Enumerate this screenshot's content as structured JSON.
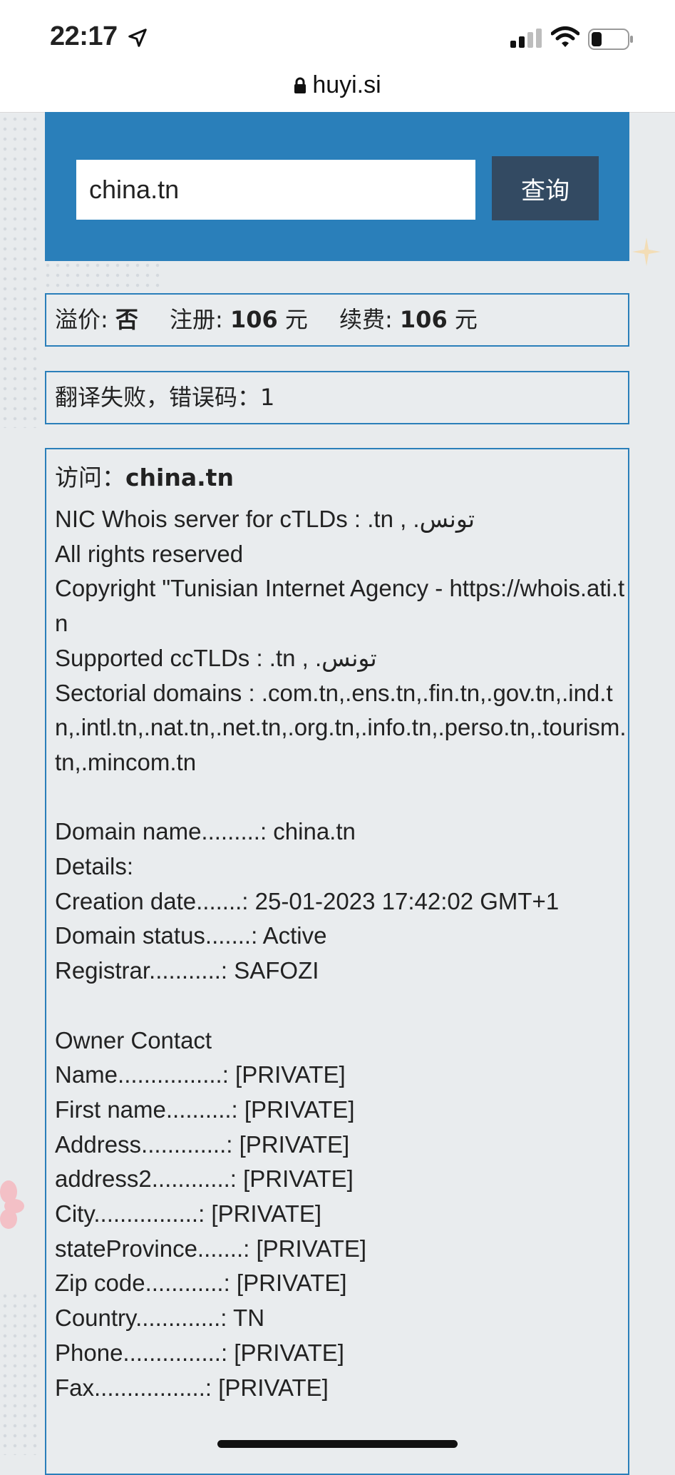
{
  "status_bar": {
    "time": "22:17",
    "icons": [
      "location-arrow-icon",
      "cellular-signal-icon",
      "wifi-icon",
      "battery-icon"
    ]
  },
  "browser": {
    "url": "huyi.si",
    "lock_icon": "lock-icon"
  },
  "search": {
    "value": "china.tn",
    "button_label": "查询"
  },
  "price": {
    "premium_label": "溢价:",
    "premium_value": "否",
    "register_label": "注册:",
    "register_value": "106",
    "register_unit": "元",
    "renew_label": "续费:",
    "renew_value": "106",
    "renew_unit": "元"
  },
  "translation_error": "翻译失败，错误码：1",
  "whois": {
    "visit_label": "访问：",
    "visit_domain": "china.tn",
    "lines": [
      "NIC Whois server for cTLDs : .tn , .تونس",
      "All rights reserved",
      "Copyright \"Tunisian Internet Agency - https://whois.ati.tn",
      "Supported ccTLDs : .tn , .تونس",
      "Sectorial domains : .com.tn,.ens.tn,.fin.tn,.gov.tn,.ind.tn,.intl.tn,.nat.tn,.net.tn,.org.tn,.info.tn,.perso.tn,.tourism.tn,.mincom.tn",
      "",
      "Domain name.........: china.tn",
      "Details:",
      "Creation date.......: 25-01-2023 17:42:02 GMT+1",
      "Domain status.......: Active",
      "Registrar...........: SAFOZI",
      "",
      "Owner Contact",
      "Name................: [PRIVATE]",
      "First name..........: [PRIVATE]",
      "Address.............: [PRIVATE]",
      "address2............: [PRIVATE]",
      "City................: [PRIVATE]",
      "stateProvince.......: [PRIVATE]",
      "Zip code............: [PRIVATE]",
      "Country.............: TN",
      "Phone...............: [PRIVATE]",
      "Fax.................: [PRIVATE]"
    ]
  },
  "colors": {
    "accent": "#2a7fba",
    "button": "#334a62",
    "background": "#e8ebed"
  }
}
